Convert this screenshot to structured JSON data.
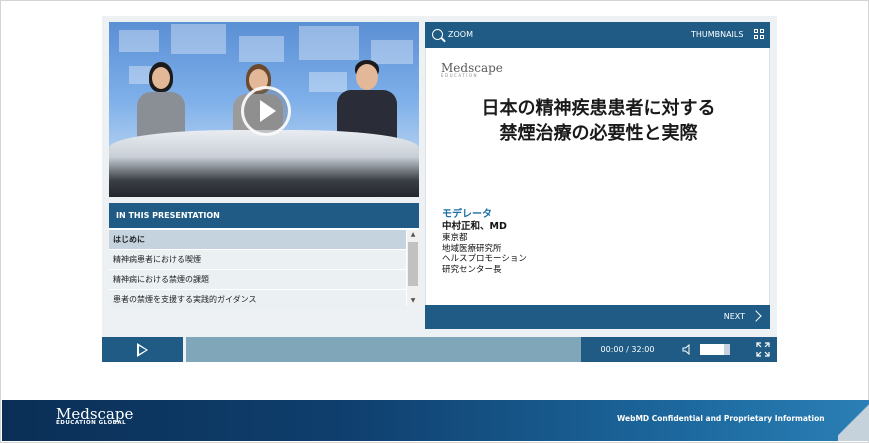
{
  "video": {
    "play_icon": "play-circle-icon"
  },
  "toc": {
    "header": "IN THIS PRESENTATION",
    "items": [
      {
        "label": "はじめに",
        "active": true
      },
      {
        "label": "精神病患者における喫煙",
        "active": false
      },
      {
        "label": "精神病における禁煙の課題",
        "active": false
      },
      {
        "label": "患者の禁煙を支援する実践的ガイダンス",
        "active": false
      }
    ]
  },
  "slide_toolbar": {
    "zoom_label": "ZOOM",
    "thumbnails_label": "THUMBNAILS"
  },
  "slide": {
    "logo": "Medscape",
    "logo_sub": "EDUCATION",
    "title_line1": "日本の精神疾患患者に対する",
    "title_line2": "禁煙治療の必要性と実際",
    "moderator_role": "モデレータ",
    "moderator_name": "中村正和、MD",
    "moderator_lines": [
      "東京都",
      "地域医療研究所",
      "ヘルスプロモーション",
      "研究センター長"
    ]
  },
  "slide_nav": {
    "next_label": "NEXT"
  },
  "controls": {
    "time": "00:00 / 32:00",
    "volume_level": 0.8
  },
  "footer": {
    "logo": "Medscape",
    "logo_sub": "EDUCATION GLOBAL",
    "text": "WebMD Confidential and Proprietary Information"
  },
  "colors": {
    "primary": "#1f5b84",
    "progress": "#7fa6b9",
    "accent_text": "#1b6fa6"
  }
}
